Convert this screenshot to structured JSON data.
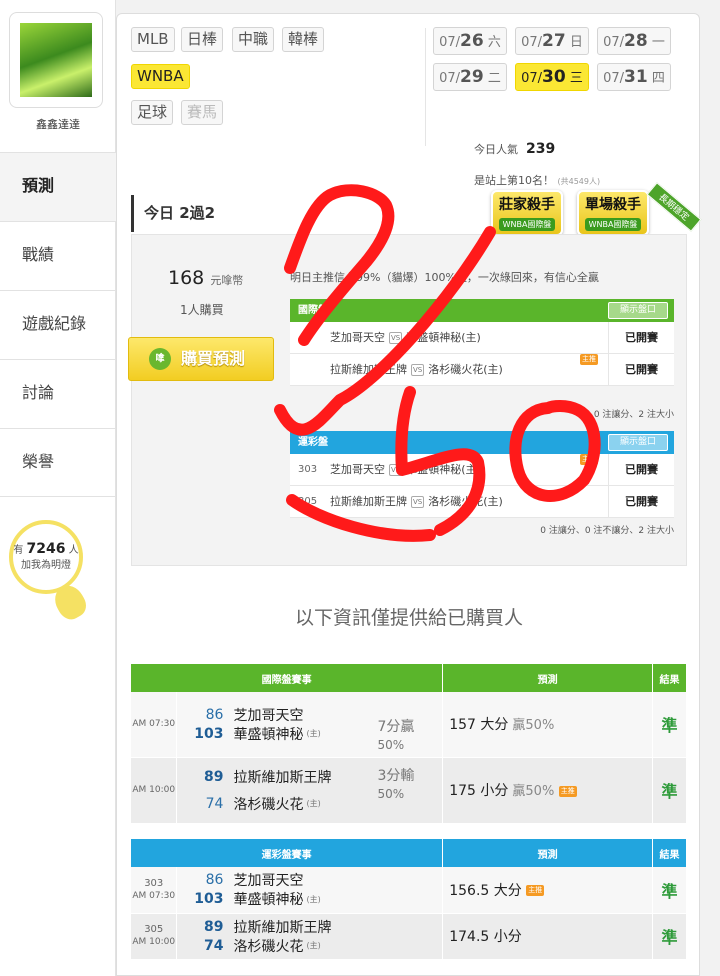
{
  "user": {
    "name": "鑫鑫達達",
    "avatar_icon": "user-avatar-image"
  },
  "nav": [
    {
      "label": "預測",
      "active": true
    },
    {
      "label": "戰績",
      "active": false
    },
    {
      "label": "遊戲紀錄",
      "active": false
    },
    {
      "label": "討論",
      "active": false
    },
    {
      "label": "榮譽",
      "active": false
    }
  ],
  "fans": {
    "prefix": "有",
    "count": "7246",
    "suffix": "人",
    "line2": "加我為明燈"
  },
  "sports": [
    "MLB",
    "日棒",
    "中職",
    "韓棒",
    "WNBA",
    "足球",
    "賽馬"
  ],
  "dates": [
    {
      "md": "07/",
      "d": "26",
      "w": "六"
    },
    {
      "md": "07/",
      "d": "27",
      "w": "日"
    },
    {
      "md": "07/",
      "d": "28",
      "w": "一"
    },
    {
      "md": "07/",
      "d": "29",
      "w": "二"
    },
    {
      "md": "07/",
      "d": "30",
      "w": "三"
    },
    {
      "md": "07/",
      "d": "31",
      "w": "四"
    }
  ],
  "popularity": {
    "label": "今日人氣",
    "value": "239",
    "rank": "是站上第10名！",
    "total": "(共4549人)"
  },
  "card": {
    "title": "今日 2過2",
    "badges": [
      {
        "title": "莊家殺手",
        "sub": "WNBA國際盤"
      },
      {
        "title": "單場殺手",
        "sub": "WNBA國際盤"
      }
    ],
    "ribbon": "長期穩定",
    "price": "168",
    "price_unit": "元嗱幣",
    "buyers": "1人購買",
    "buy_label": "購買預測",
    "buy_icon_text": "嗱",
    "note": "明日主推信心99%（貓爆）100%過，一次綠回來，有信心全贏"
  },
  "intl_mini": {
    "title": "國際盤",
    "show_label": "顯示盤口",
    "rows": [
      {
        "num": "",
        "away": "芝加哥天空",
        "home": "華盛頓神秘(主)",
        "main": false,
        "result": "已開賽"
      },
      {
        "num": "",
        "away": "拉斯維加斯王牌",
        "home": "洛杉磯火花(主)",
        "main": true,
        "result": "已開賽"
      }
    ],
    "summary": "0 注讓分、2 注大小"
  },
  "lottery_mini": {
    "title": "運彩盤",
    "show_label": "顯示盤口",
    "rows": [
      {
        "num": "303",
        "away": "芝加哥天空",
        "home": "華盛頓神秘(主)",
        "main": true,
        "result": "已開賽"
      },
      {
        "num": "305",
        "away": "拉斯維加斯王牌",
        "home": "洛杉磯火花(主)",
        "main": false,
        "result": "已開賽"
      }
    ],
    "summary": "0 注讓分、0 注不讓分、2 注大小"
  },
  "info_note": "以下資訊僅提供給已購買人",
  "main_tag": "主推",
  "home_tag": "(主)",
  "vs_tag": "VS",
  "intl_table": {
    "headers": [
      "國際盤賽事",
      "預測",
      "結果"
    ],
    "rows": [
      {
        "num": "",
        "time": "AM 07:30",
        "away_score": "86",
        "away": "芝加哥天空",
        "home_score": "103",
        "home": "華盛頓神秘",
        "hc": "7分贏",
        "hc_pct": "50%",
        "hc_row": "home",
        "pred": "157 大分",
        "win": "贏50%",
        "main": false,
        "result": "準"
      },
      {
        "num": "",
        "time": "AM 10:00",
        "away_score": "89",
        "away": "拉斯維加斯王牌",
        "home_score": "74",
        "home": "洛杉磯火花",
        "hc": "3分輸",
        "hc_pct": "50%",
        "hc_row": "away",
        "pred": "175 小分",
        "win": "贏50%",
        "main": true,
        "result": "準"
      }
    ]
  },
  "lottery_table": {
    "headers": [
      "運彩盤賽事",
      "預測",
      "結果"
    ],
    "rows": [
      {
        "num": "303",
        "time": "AM 07:30",
        "away_score": "86",
        "away": "芝加哥天空",
        "home_score": "103",
        "home": "華盛頓神秘",
        "pred": "156.5 大分",
        "main": true,
        "result": "準"
      },
      {
        "num": "305",
        "time": "AM 10:00",
        "away_score": "89",
        "away": "拉斯維加斯王牌",
        "home_score": "74",
        "home": "洛杉磯火花",
        "pred": "174.5 小分",
        "main": false,
        "result": "準"
      }
    ]
  },
  "colors": {
    "green": "#5ab52b",
    "blue": "#22a5de",
    "yellow": "#fbe734",
    "scribble": "#ff1a1a",
    "win_green": "#2e9b3a"
  }
}
